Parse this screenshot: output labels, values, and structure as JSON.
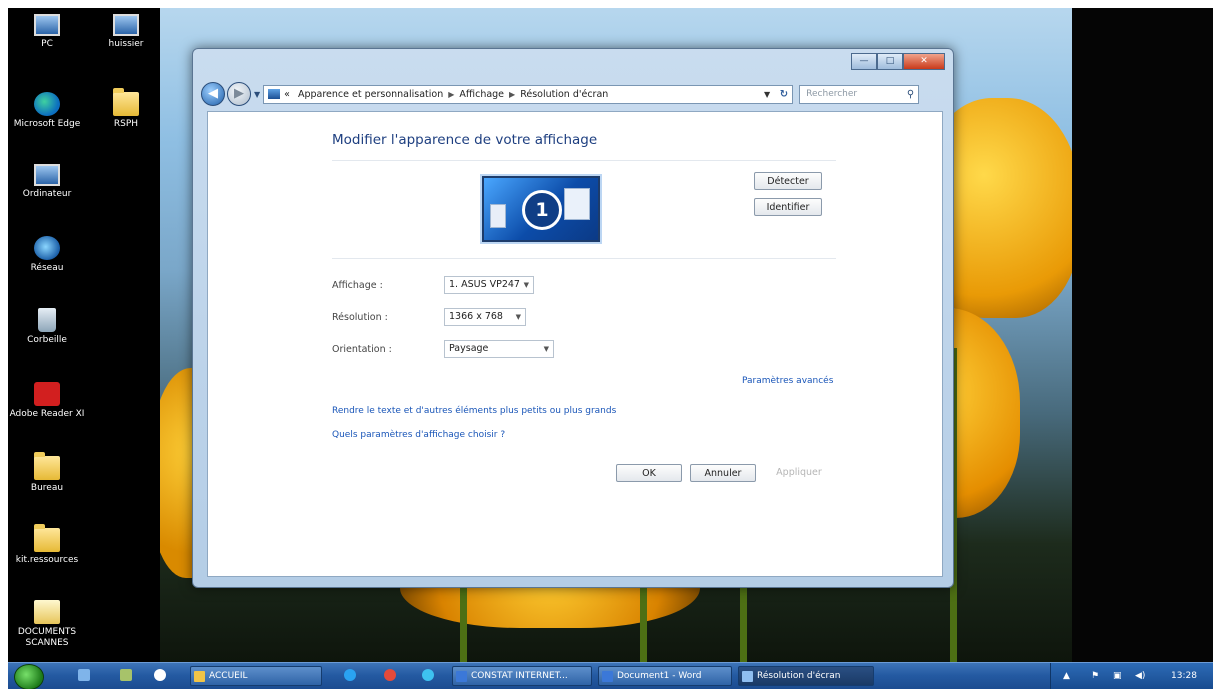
{
  "desktop": {
    "icons_left": [
      {
        "label": "PC",
        "icon": "pc-icon"
      },
      {
        "label": "Microsoft Edge",
        "icon": "edge-icon"
      },
      {
        "label": "Ordinateur",
        "icon": "computer-icon"
      },
      {
        "label": "Réseau",
        "icon": "network-icon"
      },
      {
        "label": "Corbeille",
        "icon": "recycle-bin-icon"
      },
      {
        "label": "Adobe Reader XI",
        "icon": "adobe-reader-icon"
      },
      {
        "label": "Bureau",
        "icon": "folder-icon"
      },
      {
        "label": "kit.ressources",
        "icon": "folder-icon"
      },
      {
        "label": "DOCUMENTS SCANNES",
        "icon": "documents-icon"
      }
    ],
    "icons_right": [
      {
        "label": "huissier",
        "icon": "shortcut-icon"
      },
      {
        "label": "RSPH",
        "icon": "folder-icon"
      }
    ]
  },
  "window": {
    "controls": {
      "minimize": "—",
      "maximize": "□",
      "close": "✕"
    },
    "breadcrumb": {
      "overflow": "«",
      "items": [
        "Apparence et personnalisation",
        "Affichage",
        "Résolution d'écran"
      ]
    },
    "search": {
      "placeholder": "Rechercher"
    },
    "title": "Modifier l'apparence de votre affichage",
    "monitor_number": "1",
    "buttons": {
      "detect": "Détecter",
      "identify": "Identifier"
    },
    "settings": {
      "display": {
        "label": "Affichage :",
        "value": "1. ASUS VP247"
      },
      "resolution": {
        "label": "Résolution :",
        "value": "1366 x 768"
      },
      "orientation": {
        "label": "Orientation :",
        "value": "Paysage"
      }
    },
    "links": {
      "advanced": "Paramètres avancés",
      "text_size": "Rendre le texte et d'autres éléments plus petits ou plus grands",
      "which_settings": "Quels paramètres d'affichage choisir ?"
    },
    "footer": {
      "ok": "OK",
      "cancel": "Annuler",
      "apply": "Appliquer"
    }
  },
  "taskbar": {
    "buttons": [
      {
        "label": "ACCUEIL"
      },
      {
        "label": "CONSTAT INTERNET..."
      },
      {
        "label": "Document1 - Word"
      },
      {
        "label": "Résolution d'écran"
      }
    ],
    "clock": "13:28"
  },
  "colors": {
    "link": "#1a56b8",
    "title": "#1e3f80",
    "taskbar": "#245aa2"
  }
}
